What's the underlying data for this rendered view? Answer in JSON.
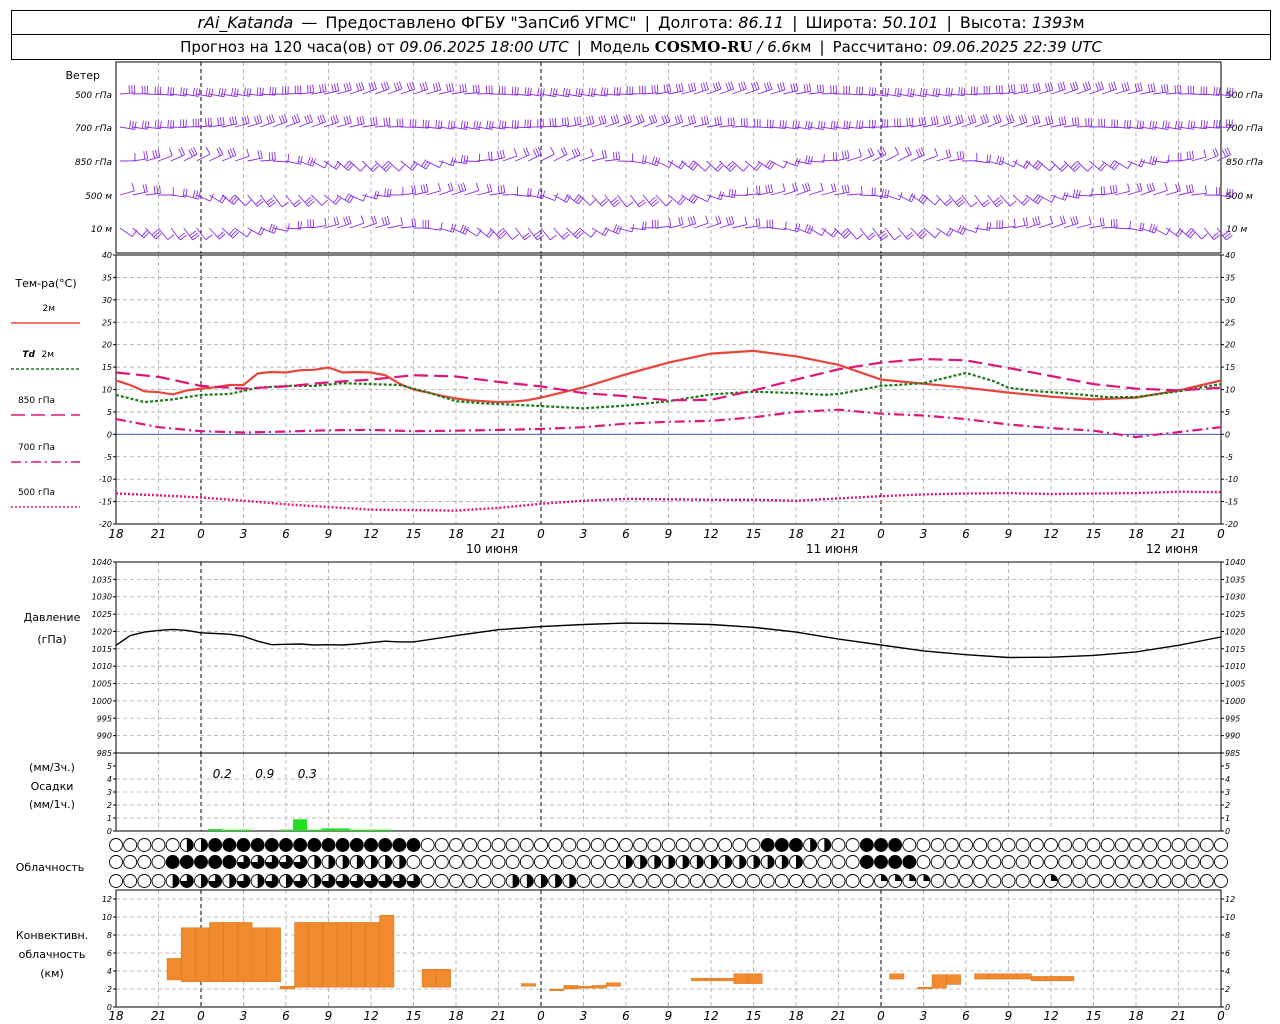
{
  "header": {
    "station": "rAi_Katanda",
    "dash": "—",
    "provider": "Предоставлено ФГБУ \"ЗапСиб УГМС\"",
    "lon_label": "Долгота:",
    "lon": "86.11",
    "lat_label": "Широта:",
    "lat": "50.101",
    "alt_label": "Высота:",
    "alt": "1393",
    "alt_unit": "м",
    "forecast_label": "Прогноз на 120 часа(ов)  от",
    "forecast_start": "09.06.2025 18:00 UTC",
    "model_label": "Модель",
    "model": "COSMO-RU",
    "slash": "/",
    "resolution": "6.6",
    "resolution_unit": "км",
    "computed_label": "Рассчитано:",
    "computed": "09.06.2025 22:39 UTC",
    "pipe": "|"
  },
  "wind_panel": {
    "title": "Ветер",
    "levels": [
      "500 гПа",
      "700 гПа",
      "850 гПа",
      "500  м",
      "10   м"
    ],
    "barb_color": "#8a2be2"
  },
  "temp_panel": {
    "title": "Тем-ра(°С)",
    "legend": [
      {
        "label": "2м",
        "italic": "",
        "color": "#e8443a",
        "dash": "none"
      },
      {
        "label": "2м",
        "italic": "Td",
        "color": "#1a7a1a",
        "dash": "3,2"
      },
      {
        "label": "850 гПа",
        "italic": "",
        "color": "#e0157a",
        "dash": "14,6"
      },
      {
        "label": "700 гПа",
        "italic": "",
        "color": "#e0157a",
        "dash": "10,4,2,4"
      },
      {
        "label": "500 гПа",
        "italic": "",
        "color": "#e0157a",
        "dash": "2,2"
      }
    ],
    "y_ticks": [
      "-20",
      "-15",
      "-10",
      "-5",
      "0",
      "5",
      "10",
      "15",
      "20",
      "25",
      "30",
      "35",
      "40"
    ]
  },
  "pressure_panel": {
    "title": "Давление",
    "unit": "(гПа)",
    "y_ticks": [
      "985",
      "990",
      "995",
      "1000",
      "1005",
      "1010",
      "1015",
      "1020",
      "1025",
      "1030",
      "1035",
      "1040"
    ]
  },
  "precip_panel": {
    "unit_3h": "(мм/3ч.)",
    "title": "Осадки",
    "unit_1h": "(мм/1ч.)",
    "y_ticks": [
      "0",
      "1",
      "2",
      "3",
      "4",
      "5"
    ],
    "totals": [
      {
        "hour": 3,
        "label": "0.2"
      },
      {
        "hour": 6,
        "label": "0.9"
      },
      {
        "hour": 9,
        "label": "0.3"
      }
    ],
    "bar_color": "#22dd22"
  },
  "cloud_panel": {
    "title": "Облачность"
  },
  "conv_panel": {
    "title": "Конвективн.",
    "title2": "облачность",
    "unit": "(км)",
    "y_ticks": [
      "0",
      "2",
      "4",
      "6",
      "8",
      "10",
      "12"
    ],
    "bar_color": "#f08a2c"
  },
  "time_axis": {
    "ticks": [
      "18",
      "21",
      "0",
      "3",
      "6",
      "9",
      "12",
      "15",
      "18",
      "21",
      "0",
      "3",
      "6",
      "9",
      "12",
      "15",
      "18",
      "21",
      "0",
      "3",
      "6",
      "9",
      "12",
      "15",
      "18",
      "21",
      "0"
    ],
    "days": [
      {
        "hour": 30,
        "label": "10 июня"
      },
      {
        "hour": 54,
        "label": "11 июня"
      },
      {
        "hour": 78,
        "label": "12 июня"
      }
    ],
    "midnights": [
      6,
      30,
      54,
      78
    ]
  },
  "chart_data": [
    {
      "type": "line",
      "title": "Тем-ра(°С)",
      "x_unit": "hours since 09.06.2025 18:00 UTC",
      "ylim": [
        -20,
        40
      ],
      "grid": true,
      "series": [
        {
          "name": "2м",
          "x": [
            0,
            1,
            2,
            3,
            4,
            5,
            6,
            7,
            8,
            9,
            10,
            11,
            12,
            13,
            14,
            15,
            16,
            17,
            18,
            19,
            20,
            21,
            22,
            23,
            24,
            25,
            26,
            27,
            28,
            29,
            30,
            33,
            36,
            39,
            42,
            45,
            48,
            51,
            54,
            57,
            60,
            63,
            66,
            69,
            72,
            75,
            78
          ],
          "y": [
            12,
            11,
            9.6,
            9.4,
            8.9,
            9.8,
            10.2,
            10.5,
            11,
            11,
            13.6,
            13.9,
            13.8,
            14.3,
            14.4,
            14.9,
            13.8,
            13.9,
            13.8,
            13.2,
            11.3,
            10,
            9.3,
            8.6,
            8,
            7.6,
            7.4,
            7.2,
            7.3,
            7.6,
            8.2,
            10.5,
            13.4,
            16,
            18,
            18.6,
            17.4,
            15.5,
            12.2,
            11.3,
            10.4,
            9.3,
            8.4,
            7.8,
            8.2,
            9.8,
            12
          ]
        },
        {
          "name": "2м Td",
          "x": [
            0,
            2,
            4,
            6,
            8,
            10,
            12,
            14,
            16,
            18,
            20,
            22,
            24,
            26,
            28,
            30,
            33,
            36,
            39,
            42,
            45,
            48,
            50,
            51,
            54,
            57,
            60,
            62,
            63,
            64,
            65,
            66,
            68,
            69,
            70,
            72,
            75,
            78
          ],
          "y": [
            8.8,
            7.2,
            7.8,
            8.8,
            9,
            10.4,
            10.8,
            10.8,
            11.4,
            11.2,
            11,
            9.4,
            7.4,
            6.9,
            6.6,
            6.3,
            5.8,
            6.4,
            7.4,
            8.9,
            9.5,
            9.2,
            8.8,
            9,
            10.8,
            11.4,
            13.7,
            11.8,
            10.4,
            10,
            9.6,
            9.4,
            8.9,
            8.6,
            8.3,
            8.3,
            9.6,
            11.2
          ]
        },
        {
          "name": "850 гПа",
          "x": [
            0,
            3,
            6,
            9,
            12,
            15,
            18,
            21,
            24,
            27,
            30,
            33,
            36,
            39,
            42,
            45,
            48,
            51,
            54,
            57,
            60,
            63,
            66,
            69,
            72,
            75,
            78
          ],
          "y": [
            13.8,
            12.8,
            10.8,
            10.2,
            10.7,
            11.6,
            12.2,
            13.2,
            12.9,
            11.7,
            10.7,
            9.2,
            8.5,
            7.6,
            7.7,
            9.8,
            12.2,
            14.5,
            16,
            16.8,
            16.5,
            14.8,
            13,
            11.2,
            10.2,
            9.8,
            10.4
          ]
        },
        {
          "name": "700 гПа",
          "x": [
            0,
            3,
            6,
            9,
            12,
            15,
            18,
            21,
            24,
            27,
            30,
            33,
            36,
            39,
            42,
            45,
            48,
            51,
            54,
            57,
            60,
            63,
            66,
            69,
            72,
            75,
            78
          ],
          "y": [
            3.4,
            1.6,
            0.7,
            0.4,
            0.6,
            0.9,
            1,
            0.7,
            0.8,
            1,
            1.2,
            1.6,
            2.4,
            2.8,
            3,
            3.8,
            5,
            5.5,
            4.6,
            4.2,
            3.4,
            2.2,
            1.4,
            0.8,
            -0.6,
            0.5,
            1.6
          ]
        },
        {
          "name": "500 гПа",
          "x": [
            0,
            3,
            6,
            9,
            12,
            15,
            18,
            21,
            24,
            27,
            30,
            33,
            36,
            39,
            42,
            45,
            48,
            51,
            54,
            57,
            60,
            63,
            66,
            69,
            72,
            75,
            78
          ],
          "y": [
            -13.2,
            -13.6,
            -14.1,
            -14.8,
            -15.6,
            -16.2,
            -16.8,
            -16.9,
            -17,
            -16.4,
            -15.5,
            -14.8,
            -14.4,
            -14.5,
            -14.6,
            -14.6,
            -14.8,
            -14.3,
            -13.8,
            -13.4,
            -13.2,
            -13.1,
            -13.3,
            -13.2,
            -13.1,
            -12.8,
            -12.9
          ]
        }
      ]
    },
    {
      "type": "line",
      "title": "Давление",
      "x_unit": "hours since 09.06.2025 18:00 UTC",
      "ylim": [
        985,
        1040
      ],
      "grid": true,
      "series": [
        {
          "name": "Давление",
          "x": [
            0,
            1,
            2,
            3,
            4,
            5,
            6,
            7,
            8,
            9,
            10,
            11,
            12,
            13,
            14,
            15,
            16,
            17,
            18,
            19,
            20,
            21,
            22,
            24,
            27,
            30,
            33,
            36,
            39,
            42,
            45,
            48,
            51,
            54,
            57,
            60,
            63,
            66,
            69,
            72,
            75,
            78
          ],
          "y": [
            1016,
            1018.8,
            1019.8,
            1020.3,
            1020.6,
            1020.3,
            1019.6,
            1019.4,
            1019.2,
            1018.6,
            1017.2,
            1016.2,
            1016.3,
            1016.4,
            1016.1,
            1016.2,
            1016.1,
            1016.4,
            1016.8,
            1017.2,
            1017,
            1017,
            1017.6,
            1018.8,
            1020.5,
            1021.4,
            1022,
            1022.4,
            1022.3,
            1022,
            1021.2,
            1019.8,
            1017.8,
            1016.1,
            1014.4,
            1013.3,
            1012.5,
            1012.6,
            1013.1,
            1014.1,
            1016,
            1018.4
          ]
        }
      ]
    },
    {
      "type": "bar",
      "title": "Осадки",
      "x_unit": "hours since 09.06.2025 18:00 UTC",
      "ylim": [
        0,
        5
      ],
      "series": [
        {
          "name": "(мм/1ч.)",
          "x": [
            7,
            8,
            9,
            10,
            11,
            12,
            13,
            14,
            15,
            16,
            17,
            18,
            19,
            20,
            21
          ],
          "y": [
            0.15,
            0.1,
            0.1,
            0,
            0,
            0.1,
            0.9,
            0.1,
            0.2,
            0.2,
            0.1,
            0.1,
            0.1,
            0,
            0
          ]
        }
      ]
    },
    {
      "type": "bar",
      "title": "Конвективн. облачность",
      "x_unit": "hours since 09.06.2025 18:00 UTC",
      "ylim": [
        0,
        12
      ],
      "series": [
        {
          "name": "(км)",
          "ranges": [
            [
              3.6,
              4.6,
              3,
              5.4
            ],
            [
              4.6,
              5.6,
              2.8,
              8.8
            ],
            [
              5.6,
              6.6,
              2.8,
              8.8
            ],
            [
              6.6,
              7.6,
              2.8,
              9.4
            ],
            [
              7.6,
              8.6,
              2.8,
              9.4
            ],
            [
              8.6,
              9.6,
              2.8,
              9.4
            ],
            [
              9.6,
              10.6,
              2.8,
              8.8
            ],
            [
              10.6,
              11.6,
              2.8,
              8.8
            ],
            [
              11.6,
              12.6,
              2,
              2.3
            ],
            [
              12.6,
              13.6,
              2.2,
              9.4
            ],
            [
              13.6,
              14.6,
              2.2,
              9.4
            ],
            [
              14.6,
              15.6,
              2.2,
              9.4
            ],
            [
              15.6,
              16.6,
              2.2,
              9.4
            ],
            [
              16.6,
              17.6,
              2.2,
              9.4
            ],
            [
              17.6,
              18.6,
              2.2,
              9.4
            ],
            [
              18.6,
              19.6,
              2.2,
              10.2
            ],
            [
              21.6,
              22.6,
              2.2,
              4.2
            ],
            [
              22.6,
              23.6,
              2.2,
              4.2
            ],
            [
              28.6,
              29.6,
              2.3,
              2.6
            ],
            [
              30.6,
              31.6,
              1.8,
              2
            ],
            [
              31.6,
              32.6,
              2,
              2.4
            ],
            [
              32.6,
              33.6,
              2.1,
              2.3
            ],
            [
              33.6,
              34.6,
              2.1,
              2.4
            ],
            [
              34.6,
              35.6,
              2.3,
              2.7
            ],
            [
              40.6,
              41.6,
              2.9,
              3.2
            ],
            [
              41.6,
              42.6,
              2.9,
              3.2
            ],
            [
              42.6,
              43.6,
              2.9,
              3.2
            ],
            [
              43.6,
              44.6,
              2.6,
              3.7
            ],
            [
              44.6,
              45.6,
              2.6,
              3.7
            ],
            [
              54.6,
              55.6,
              3.1,
              3.7
            ],
            [
              56.6,
              57.6,
              2,
              2.2
            ],
            [
              57.6,
              58.6,
              2.1,
              3.6
            ],
            [
              58.6,
              59.6,
              2.5,
              3.6
            ],
            [
              60.6,
              61.6,
              3.1,
              3.7
            ],
            [
              61.6,
              62.6,
              3.1,
              3.7
            ],
            [
              62.6,
              63.6,
              3.1,
              3.7
            ],
            [
              63.6,
              64.6,
              3.1,
              3.7
            ],
            [
              64.6,
              65.6,
              2.9,
              3.4
            ],
            [
              65.6,
              66.6,
              2.9,
              3.4
            ],
            [
              66.6,
              67.6,
              2.9,
              3.4
            ]
          ]
        }
      ]
    }
  ]
}
